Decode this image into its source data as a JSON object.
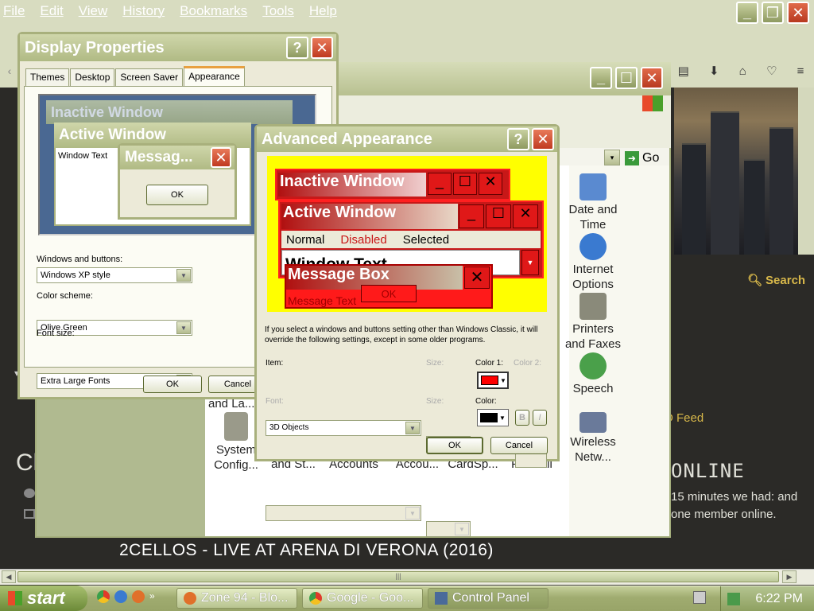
{
  "firefox": {
    "menu": [
      "File",
      "Edit",
      "View",
      "History",
      "Bookmarks",
      "Tools",
      "Help"
    ]
  },
  "page": {
    "search_label": "Search",
    "feed_text": "D Feed",
    "online_heading": "ONLINE",
    "online_body": "15 minutes we had: and one member online.",
    "post_title": "2CELLOS - LIVE AT ARENA DI VERONA (2016)",
    "left_heading": "Cl"
  },
  "control_panel": {
    "address_go": "Go",
    "icons": [
      {
        "label": "Date and Time",
        "color": "#5a8ad0"
      },
      {
        "label": "Internet Options",
        "color": "#3a7ad0"
      },
      {
        "label": "Printers and Faxes",
        "color": "#8a8a7a"
      },
      {
        "label": "Speech",
        "color": "#4aa04a"
      },
      {
        "label": "Wireless Netw...",
        "color": "#6a7a9a"
      }
    ],
    "bottom_icons": [
      {
        "label": "System Config..."
      },
      {
        "label": "and St..."
      },
      {
        "label": "Accounts"
      },
      {
        "label": "Accou..."
      },
      {
        "label": "CardSp..."
      },
      {
        "label": "Firewall"
      }
    ],
    "partial_label": "and La..."
  },
  "display_properties": {
    "title": "Display Properties",
    "tabs": [
      "Themes",
      "Desktop",
      "Screen Saver",
      "Appearance"
    ],
    "selected_tab": "Appearance",
    "preview": {
      "inactive": "Inactive Window",
      "active": "Active Window",
      "window_text": "Window Text",
      "message": "Messag...",
      "ok": "OK"
    },
    "windows_buttons_label": "Windows and buttons:",
    "windows_buttons_value": "Windows XP style",
    "color_scheme_label": "Color scheme:",
    "color_scheme_value": "Olive Green",
    "font_size_label": "Font size:",
    "font_size_value": "Extra Large Fonts",
    "ok": "OK",
    "cancel": "Cancel"
  },
  "advanced": {
    "title": "Advanced Appearance",
    "preview": {
      "inactive": "Inactive Window",
      "active": "Active Window",
      "normal": "Normal",
      "disabled": "Disabled",
      "selected": "Selected",
      "window_text": "Window Text",
      "message_box": "Message Box",
      "message_text": "Message Text",
      "ok": "OK"
    },
    "note": "If you select a windows and buttons setting other than Windows Classic, it will override the following settings, except in some older programs.",
    "item_label": "Item:",
    "item_value": "3D Objects",
    "size_label": "Size:",
    "color1_label": "Color 1:",
    "color2_label": "Color 2:",
    "font_label": "Font:",
    "size2_label": "Size:",
    "color_label": "Color:",
    "bold": "B",
    "italic": "I",
    "ok": "OK",
    "cancel": "Cancel",
    "color1_value": "#ff0000",
    "font_color_value": "#000000"
  },
  "taskbar": {
    "start": "start",
    "tasks": [
      "Zone 94 - Blo...",
      "Google - Goo...",
      "Control Panel"
    ],
    "clock": "6:22 PM"
  }
}
